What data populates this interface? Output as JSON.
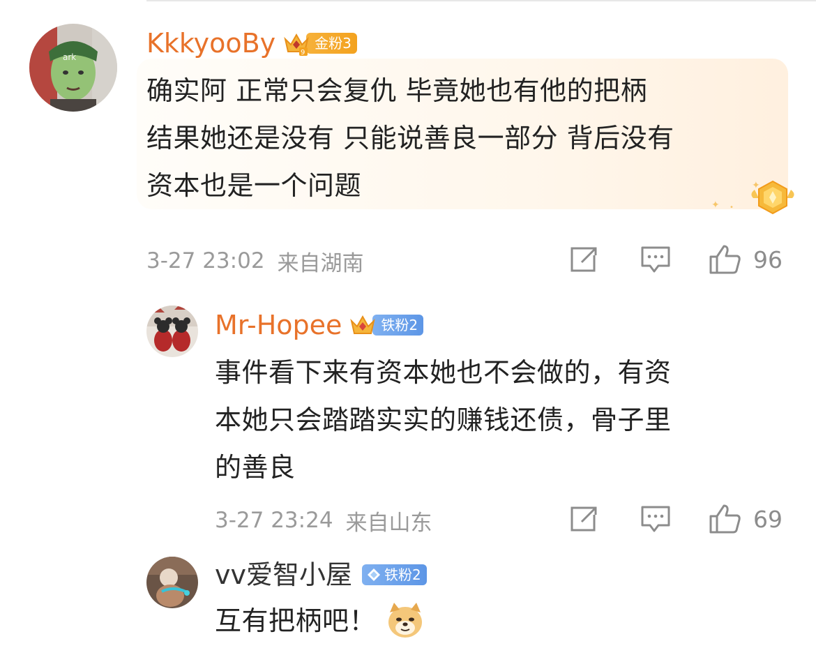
{
  "comments": [
    {
      "username": "KkkyooBy",
      "fan_badge": {
        "label": "金粉3",
        "color": "#f3a21f",
        "crown": "crown-icon"
      },
      "lines": [
        "确实阿 正常只会复仇 毕竟她也有他的把柄",
        "结果她还是没有 只能说善良一部分 背后没有",
        "资本也是一个问题"
      ],
      "time": "3-27 23:02",
      "location": "来自湖南",
      "like_count": "96"
    },
    {
      "username": "Mr-Hopee",
      "fan_badge": {
        "label": "铁粉2",
        "color": "#5d96e6",
        "crown": "crown-icon"
      },
      "lines": [
        "事件看下来有资本她也不会做的，有资",
        "本她只会踏踏实实的赚钱还债，骨子里",
        "的善良"
      ],
      "time": "3-27 23:24",
      "location": "来自山东",
      "like_count": "69"
    },
    {
      "username": "vv爱智小屋",
      "fan_badge": {
        "label": "铁粉2",
        "color": "#5d96e6",
        "crown": "diamond-icon"
      },
      "lines": [
        "互有把柄吧！"
      ],
      "emoji": "doge-emoji"
    }
  ],
  "icons": {
    "repost": "repost-icon",
    "comment": "comment-icon",
    "like": "like-icon"
  },
  "colors": {
    "username": "#e8722a",
    "meta": "#9a9a9a",
    "gold_badge": "#f3a21f",
    "blue_badge": "#5d96e6"
  }
}
